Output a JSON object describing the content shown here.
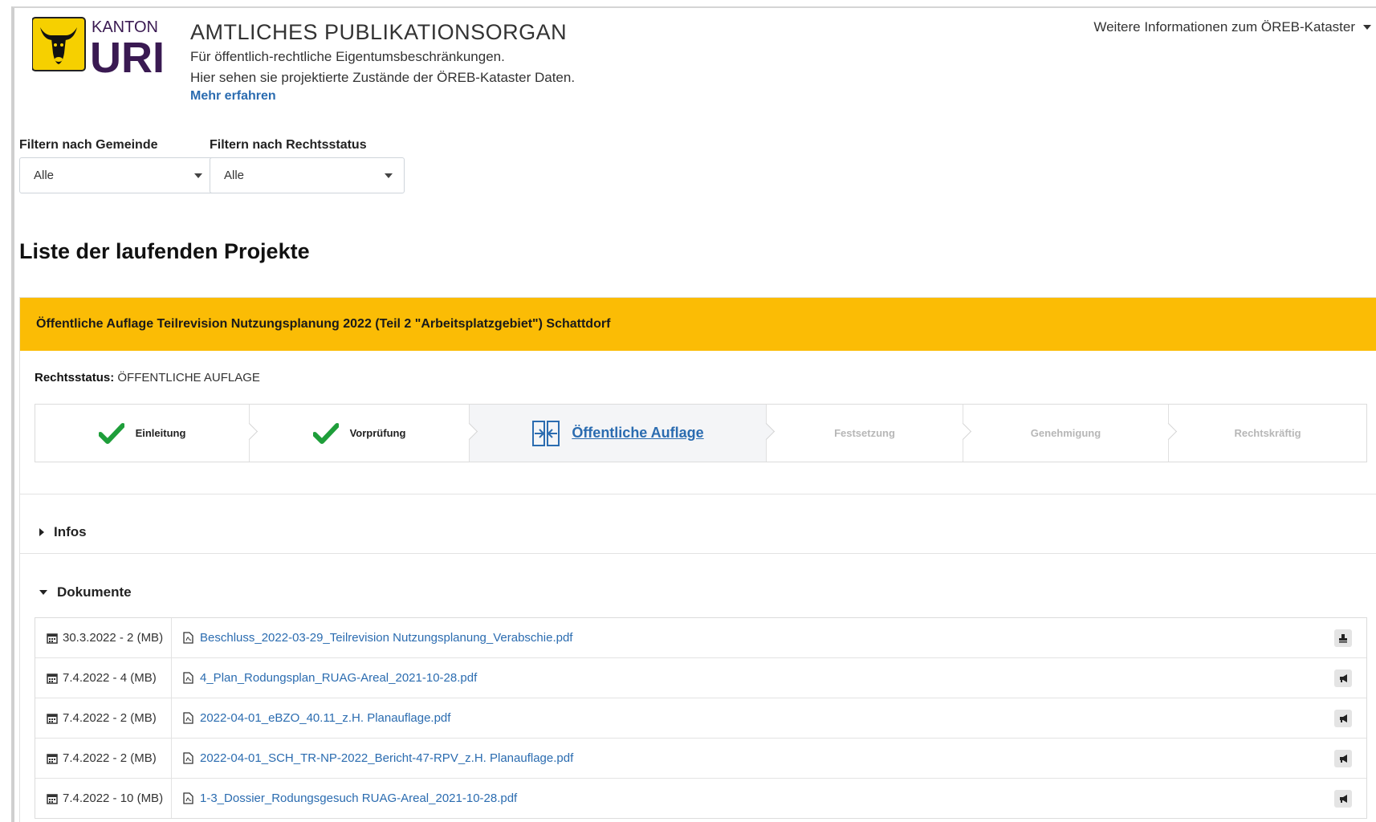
{
  "header": {
    "logo_kanton": "KANTON",
    "logo_uri": "URI",
    "title": "AMTLICHES PUBLIKATIONSORGAN",
    "line1": "Für öffentlich-rechtliche Eigentumsbeschränkungen.",
    "line2": "Hier sehen sie projektierte Zustände der ÖREB-Kataster Daten.",
    "more_link": "Mehr erfahren",
    "info_menu": "Weitere Informationen zum ÖREB-Kataster"
  },
  "filters": [
    {
      "label": "Filtern nach Gemeinde",
      "value": "Alle"
    },
    {
      "label": "Filtern nach Rechtsstatus",
      "value": "Alle"
    }
  ],
  "list_title": "Liste der laufenden Projekte",
  "project": {
    "title": "Öffentliche Auflage Teilrevision Nutzungsplanung 2022 (Teil 2 \"Arbeitsplatzgebiet\") Schattdorf",
    "status_label": "Rechtsstatus:",
    "status_value": "ÖFFENTLICHE AUFLAGE",
    "steps": [
      {
        "label": "Einleitung",
        "state": "done"
      },
      {
        "label": "Vorprüfung",
        "state": "done"
      },
      {
        "label": "Öffentliche Auflage",
        "state": "active"
      },
      {
        "label": "Festsetzung",
        "state": "pending"
      },
      {
        "label": "Genehmigung",
        "state": "pending"
      },
      {
        "label": "Rechtskräftig",
        "state": "pending"
      }
    ],
    "infos_label": "Infos",
    "docs_label": "Dokumente",
    "documents": [
      {
        "date": "30.3.2022 - 2 (MB)",
        "file": "Beschluss_2022-03-29_Teilrevision Nutzungsplanung_Verabschie.pdf",
        "action_icon": "stamp-icon"
      },
      {
        "date": "7.4.2022 - 4 (MB)",
        "file": "4_Plan_Rodungsplan_RUAG-Areal_2021-10-28.pdf",
        "action_icon": "megaphone-icon"
      },
      {
        "date": "7.4.2022 - 2 (MB)",
        "file": "2022-04-01_eBZO_40.11_z.H. Planauflage.pdf",
        "action_icon": "megaphone-icon"
      },
      {
        "date": "7.4.2022 - 2 (MB)",
        "file": "2022-04-01_SCH_TR-NP-2022_Bericht-47-RPV_z.H. Planauflage.pdf",
        "action_icon": "megaphone-icon"
      },
      {
        "date": "7.4.2022 - 10 (MB)",
        "file": "1-3_Dossier_Rodungsgesuch RUAG-Areal_2021-10-28.pdf",
        "action_icon": "megaphone-icon"
      }
    ]
  },
  "colors": {
    "accent": "#fbbc05",
    "link": "#2b6cb0",
    "check": "#1e9e3a",
    "logo_yellow": "#f6d000",
    "logo_purple": "#3a1a52"
  }
}
